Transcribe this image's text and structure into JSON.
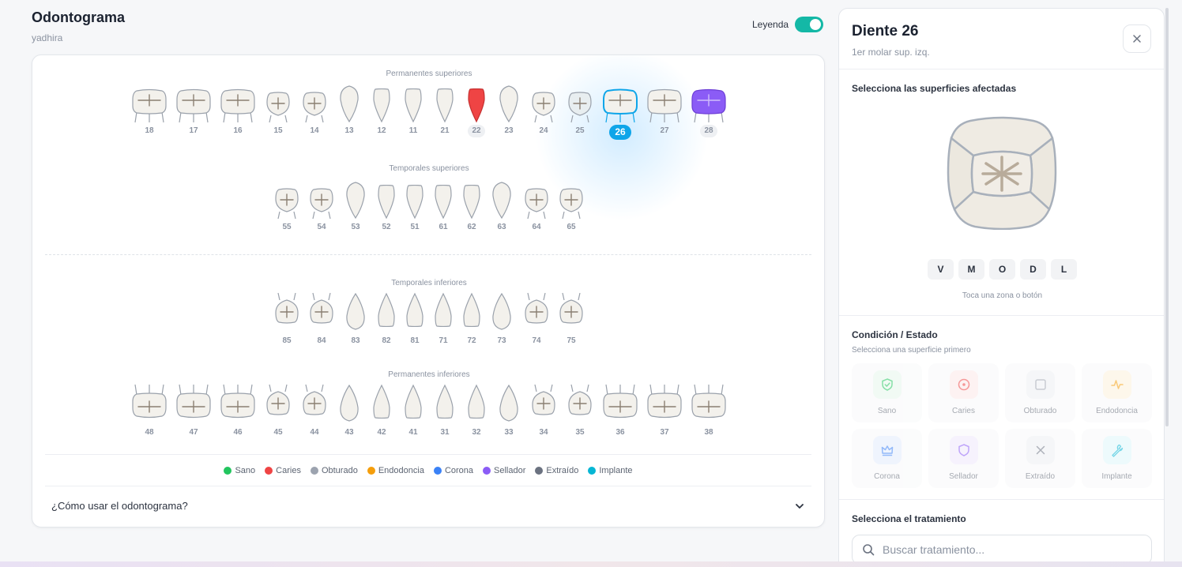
{
  "header": {
    "title": "Odontograma",
    "subtitle": "yadhira"
  },
  "legend_toggle": {
    "label": "Leyenda",
    "on": true
  },
  "rows": [
    {
      "key": "perm_sup",
      "label": "Permanentes superiores",
      "teeth": [
        {
          "n": "18",
          "type": "molar"
        },
        {
          "n": "17",
          "type": "molar"
        },
        {
          "n": "16",
          "type": "molar"
        },
        {
          "n": "15",
          "type": "premolar"
        },
        {
          "n": "14",
          "type": "premolar"
        },
        {
          "n": "13",
          "type": "canine"
        },
        {
          "n": "12",
          "type": "incisor"
        },
        {
          "n": "11",
          "type": "incisor"
        },
        {
          "n": "21",
          "type": "incisor"
        },
        {
          "n": "22",
          "type": "incisor",
          "state": "caries",
          "pill": true
        },
        {
          "n": "23",
          "type": "canine"
        },
        {
          "n": "24",
          "type": "premolar"
        },
        {
          "n": "25",
          "type": "premolar",
          "tint": true
        },
        {
          "n": "26",
          "type": "molar",
          "selected": true
        },
        {
          "n": "27",
          "type": "molar"
        },
        {
          "n": "28",
          "type": "molar",
          "state": "sellador",
          "pill": true
        }
      ]
    },
    {
      "key": "temp_sup",
      "label": "Temporales superiores",
      "teeth": [
        {
          "n": "55",
          "type": "premolar"
        },
        {
          "n": "54",
          "type": "premolar"
        },
        {
          "n": "53",
          "type": "canine"
        },
        {
          "n": "52",
          "type": "incisor"
        },
        {
          "n": "51",
          "type": "incisor"
        },
        {
          "n": "61",
          "type": "incisor"
        },
        {
          "n": "62",
          "type": "incisor"
        },
        {
          "n": "63",
          "type": "canine"
        },
        {
          "n": "64",
          "type": "premolar"
        },
        {
          "n": "65",
          "type": "premolar"
        }
      ]
    },
    {
      "key": "temp_inf",
      "label": "Temporales inferiores",
      "teeth": [
        {
          "n": "85",
          "type": "premolar"
        },
        {
          "n": "84",
          "type": "premolar"
        },
        {
          "n": "83",
          "type": "canine"
        },
        {
          "n": "82",
          "type": "incisor"
        },
        {
          "n": "81",
          "type": "incisor"
        },
        {
          "n": "71",
          "type": "incisor"
        },
        {
          "n": "72",
          "type": "incisor"
        },
        {
          "n": "73",
          "type": "canine"
        },
        {
          "n": "74",
          "type": "premolar"
        },
        {
          "n": "75",
          "type": "premolar"
        }
      ]
    },
    {
      "key": "perm_inf",
      "label": "Permanentes inferiores",
      "teeth": [
        {
          "n": "48",
          "type": "molar"
        },
        {
          "n": "47",
          "type": "molar"
        },
        {
          "n": "46",
          "type": "molar"
        },
        {
          "n": "45",
          "type": "premolar"
        },
        {
          "n": "44",
          "type": "premolar"
        },
        {
          "n": "43",
          "type": "canine"
        },
        {
          "n": "42",
          "type": "incisor"
        },
        {
          "n": "41",
          "type": "incisor"
        },
        {
          "n": "31",
          "type": "incisor"
        },
        {
          "n": "32",
          "type": "incisor"
        },
        {
          "n": "33",
          "type": "canine"
        },
        {
          "n": "34",
          "type": "premolar"
        },
        {
          "n": "35",
          "type": "premolar"
        },
        {
          "n": "36",
          "type": "molar"
        },
        {
          "n": "37",
          "type": "molar"
        },
        {
          "n": "38",
          "type": "molar"
        }
      ]
    }
  ],
  "legend": [
    {
      "label": "Sano",
      "color": "#22c55e"
    },
    {
      "label": "Caries",
      "color": "#ef4444"
    },
    {
      "label": "Obturado",
      "color": "#9ca3af"
    },
    {
      "label": "Endodoncia",
      "color": "#f59e0b"
    },
    {
      "label": "Corona",
      "color": "#3b82f6"
    },
    {
      "label": "Sellador",
      "color": "#8b5cf6"
    },
    {
      "label": "Extraído",
      "color": "#6b7280"
    },
    {
      "label": "Implante",
      "color": "#06b6d4"
    }
  ],
  "howto": {
    "label": "¿Cómo usar el odontograma?"
  },
  "panel": {
    "title": "Diente 26",
    "subtitle": "1er molar sup. izq.",
    "surfaces_title": "Selecciona las superficies afectadas",
    "surfaces": [
      "V",
      "M",
      "O",
      "D",
      "L"
    ],
    "hint": "Toca una zona o botón",
    "condition_title": "Condición / Estado",
    "condition_sub": "Selecciona una superficie primero",
    "conditions": [
      {
        "label": "Sano",
        "icon": "shield-check-icon",
        "color": "#22c55e",
        "bg": "#e6f7ec"
      },
      {
        "label": "Caries",
        "icon": "target-icon",
        "color": "#ef4444",
        "bg": "#fde8e8"
      },
      {
        "label": "Obturado",
        "icon": "square-icon",
        "color": "#9ca3af",
        "bg": "#eef0f3"
      },
      {
        "label": "Endodoncia",
        "icon": "pulse-icon",
        "color": "#f59e0b",
        "bg": "#fdf1dc"
      },
      {
        "label": "Corona",
        "icon": "crown-icon",
        "color": "#3b82f6",
        "bg": "#e3ecfd"
      },
      {
        "label": "Sellador",
        "icon": "shield-icon",
        "color": "#8b5cf6",
        "bg": "#efe8fd"
      },
      {
        "label": "Extraído",
        "icon": "x-icon",
        "color": "#6b7280",
        "bg": "#eef0f3"
      },
      {
        "label": "Implante",
        "icon": "wrench-icon",
        "color": "#06b6d4",
        "bg": "#e0f6fa"
      }
    ],
    "treatment_title": "Selecciona el tratamiento",
    "search_placeholder": "Buscar tratamiento..."
  }
}
